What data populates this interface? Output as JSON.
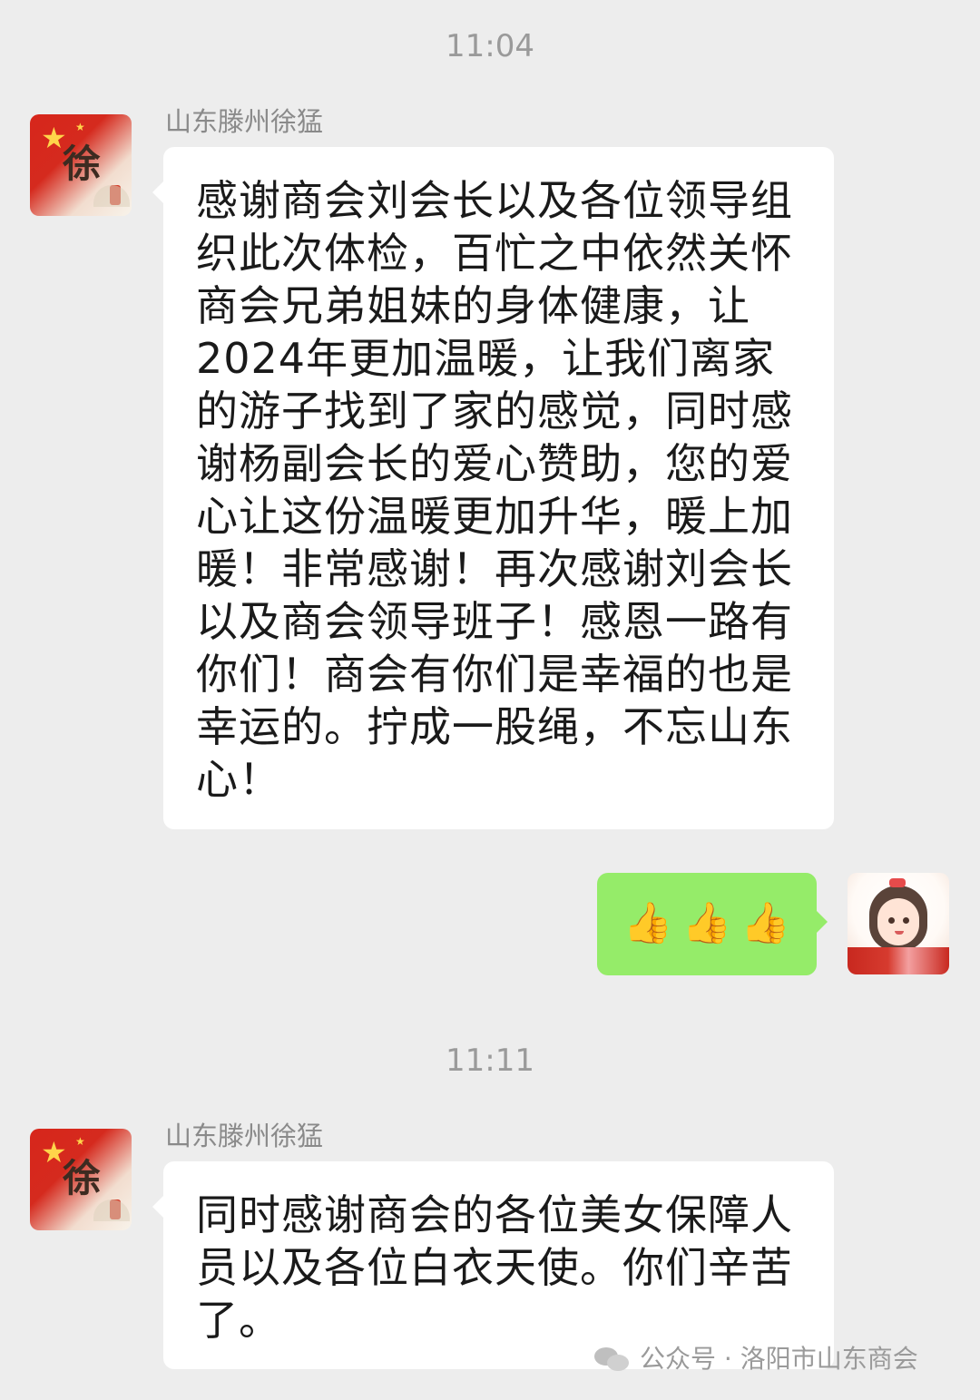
{
  "timestamps": [
    "11:04",
    "11:11"
  ],
  "messages": [
    {
      "sender": "山东滕州徐猛",
      "text": "感谢商会刘会长以及各位领导组织此次体检，百忙之中依然关怀商会兄弟姐妹的身体健康，让2024年更加温暖，让我们离家的游子找到了家的感觉，同时感谢杨副会长的爱心赞助，您的爱心让这份温暖更加升华，暖上加暖！非常感谢！再次感谢刘会长以及商会领导班子！感恩一路有你们！商会有你们是幸福的也是幸运的。拧成一股绳，不忘山东心！"
    },
    {
      "sender": "self",
      "emoji": [
        "👍",
        "👍",
        "👍"
      ]
    },
    {
      "sender": "山东滕州徐猛",
      "text": "同时感谢商会的各位美女保障人员以及各位白衣天使。你们辛苦了。"
    }
  ],
  "avatar_left_label": "徐",
  "watermark": {
    "text": "公众号 · 洛阳市山东商会"
  },
  "icons": {
    "thumb": "thumbs-up-icon",
    "watermark": "wechat-icon"
  },
  "colors": {
    "background": "#ededed",
    "self_bubble": "#95ec69",
    "other_bubble": "#ffffff",
    "timestamp": "#9a9a9a"
  }
}
